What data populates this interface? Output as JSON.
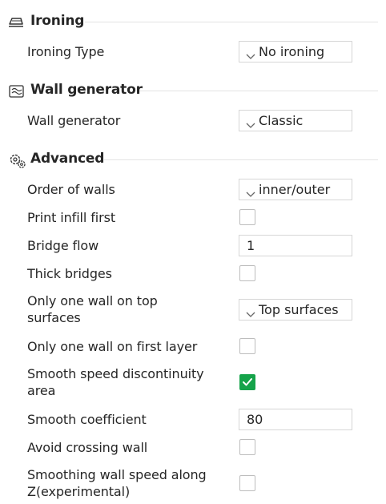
{
  "sections": [
    {
      "title": "Ironing",
      "icon": "iron-icon",
      "rows": [
        {
          "label_lines": [
            "Ironing Type"
          ],
          "control": "combo",
          "value": "No ironing"
        }
      ]
    },
    {
      "title": "Wall generator",
      "icon": "wall-generator-icon",
      "rows": [
        {
          "label_lines": [
            "Wall generator"
          ],
          "control": "combo",
          "value": "Classic"
        }
      ]
    },
    {
      "title": "Advanced",
      "icon": "gears-icon",
      "rows": [
        {
          "label_lines": [
            "Order of walls"
          ],
          "control": "combo",
          "value": "inner/outer"
        },
        {
          "label_lines": [
            "Print infill first"
          ],
          "control": "checkbox",
          "checked": false
        },
        {
          "label_lines": [
            "Bridge flow"
          ],
          "control": "text",
          "value": "1"
        },
        {
          "label_lines": [
            "Thick bridges"
          ],
          "control": "checkbox",
          "checked": false
        },
        {
          "label_lines": [
            "Only one wall on top",
            "surfaces"
          ],
          "control": "combo",
          "value": "Top surfaces"
        },
        {
          "label_lines": [
            "Only one wall on first layer"
          ],
          "control": "checkbox",
          "checked": false
        },
        {
          "label_lines": [
            "Smooth speed discontinuity",
            "area"
          ],
          "control": "checkbox",
          "checked": true
        },
        {
          "label_lines": [
            "Smooth coefficient"
          ],
          "control": "text",
          "value": "80"
        },
        {
          "label_lines": [
            "Avoid crossing wall"
          ],
          "control": "checkbox",
          "checked": false
        },
        {
          "label_lines": [
            "Smoothing wall speed along",
            "Z(experimental)"
          ],
          "control": "checkbox",
          "checked": false
        }
      ]
    }
  ],
  "colors": {
    "check_accent": "#15a34a",
    "border": "#d6d6d6",
    "text": "#262626"
  }
}
